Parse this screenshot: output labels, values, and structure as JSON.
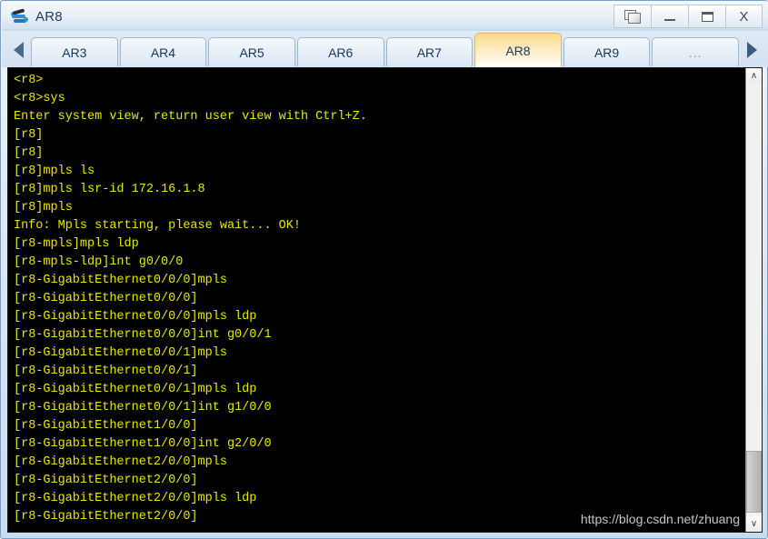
{
  "window": {
    "title": "AR8",
    "icon": "router-icon",
    "controls": [
      {
        "name": "cascade-windows-button",
        "label": ""
      },
      {
        "name": "minimize-button",
        "label": ""
      },
      {
        "name": "maximize-button",
        "label": ""
      },
      {
        "name": "close-button",
        "label": "X"
      }
    ]
  },
  "tabbar": {
    "scroll_left": "◀",
    "scroll_right": "▶",
    "tabs": [
      {
        "label": "AR3",
        "active": false
      },
      {
        "label": "AR4",
        "active": false
      },
      {
        "label": "AR5",
        "active": false
      },
      {
        "label": "AR6",
        "active": false
      },
      {
        "label": "AR7",
        "active": false
      },
      {
        "label": "AR8",
        "active": true
      },
      {
        "label": "AR9",
        "active": false
      },
      {
        "label": "...",
        "active": false
      }
    ]
  },
  "terminal": {
    "foreground_color": "#e8e800",
    "background_color": "#000000",
    "lines": [
      "<r8>",
      "<r8>sys",
      "Enter system view, return user view with Ctrl+Z.",
      "[r8]",
      "[r8]",
      "[r8]mpls ls",
      "[r8]mpls lsr-id 172.16.1.8",
      "[r8]mpls",
      "Info: Mpls starting, please wait... OK!",
      "[r8-mpls]mpls ldp",
      "[r8-mpls-ldp]int g0/0/0",
      "[r8-GigabitEthernet0/0/0]mpls",
      "[r8-GigabitEthernet0/0/0]",
      "[r8-GigabitEthernet0/0/0]mpls ldp",
      "[r8-GigabitEthernet0/0/0]int g0/0/1",
      "[r8-GigabitEthernet0/0/1]mpls",
      "[r8-GigabitEthernet0/0/1]",
      "[r8-GigabitEthernet0/0/1]mpls ldp",
      "[r8-GigabitEthernet0/0/1]int g1/0/0",
      "[r8-GigabitEthernet1/0/0]",
      "[r8-GigabitEthernet1/0/0]int g2/0/0",
      "[r8-GigabitEthernet2/0/0]mpls",
      "[r8-GigabitEthernet2/0/0]",
      "[r8-GigabitEthernet2/0/0]mpls ldp",
      "[r8-GigabitEthernet2/0/0]"
    ],
    "watermark": "https://blog.csdn.net/zhuang"
  },
  "scrollbar": {
    "up_arrow": "∧",
    "down_arrow": "∨"
  }
}
